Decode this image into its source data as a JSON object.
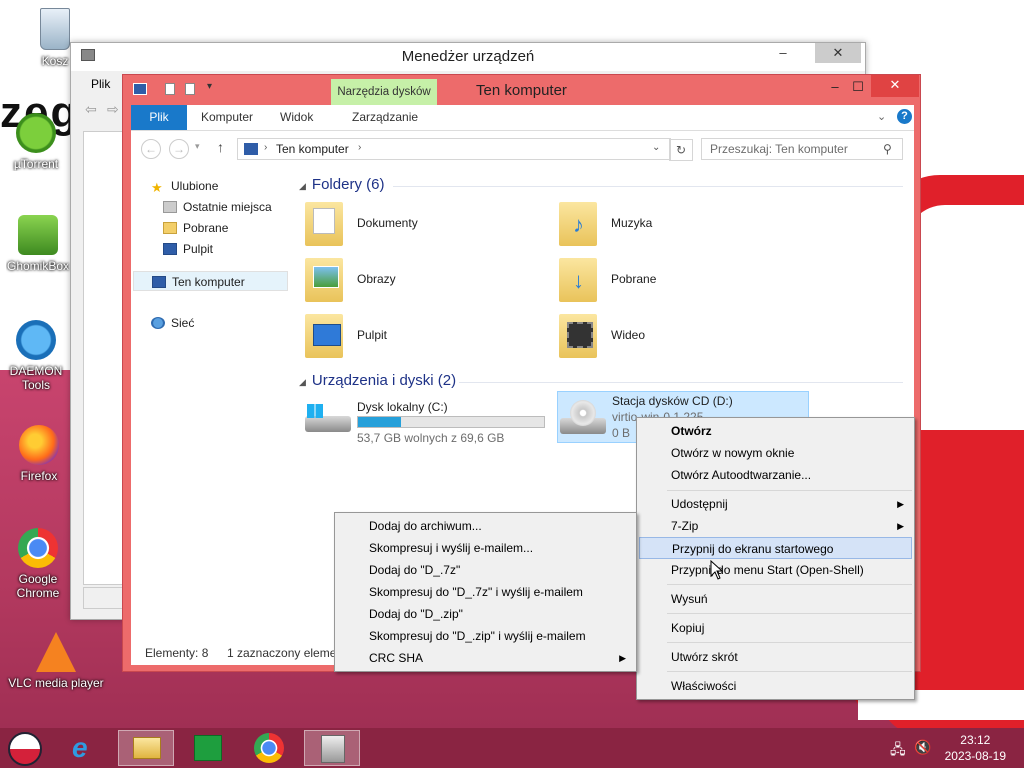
{
  "desktop": {
    "icons": [
      {
        "label": "Kosz",
        "icon": "recycle-bin-icon"
      },
      {
        "label": "µTorrent",
        "icon": "utorrent-icon"
      },
      {
        "label": "GhomikBox",
        "icon": "chomikbox-icon"
      },
      {
        "label": "DAEMON Tools",
        "icon": "daemon-tools-icon"
      },
      {
        "label": "Firefox",
        "icon": "firefox-icon"
      },
      {
        "label": "Google Chrome",
        "icon": "chrome-icon"
      },
      {
        "label": "VLC media player",
        "icon": "vlc-icon"
      }
    ],
    "wallpaper_text": "zeg"
  },
  "device_manager": {
    "title": "Menedżer urządzeń",
    "menu_file": "Plik"
  },
  "explorer": {
    "title": "Ten komputer",
    "ribbon": {
      "tabs": [
        "Plik",
        "Komputer",
        "Widok",
        "Zarządzanie"
      ],
      "contextual_tab": "Narzędzia dysków"
    },
    "address": {
      "path": "Ten komputer"
    },
    "search": {
      "placeholder": "Przeszukaj: Ten komputer"
    },
    "nav": {
      "favorites_label": "Ulubione",
      "favorites": [
        "Ostatnie miejsca",
        "Pobrane",
        "Pulpit"
      ],
      "this_pc": "Ten komputer",
      "network": "Sieć"
    },
    "folders_group": "Foldery (6)",
    "folders": [
      "Dokumenty",
      "Muzyka",
      "Obrazy",
      "Pobrane",
      "Pulpit",
      "Wideo"
    ],
    "devices_group": "Urządzenia i dyski (2)",
    "drives": [
      {
        "name": "Dysk lokalny (C:)",
        "free": "53,7 GB wolnych z 69,6 GB",
        "used_fraction": 0.23
      },
      {
        "name": "Stacja dysków CD (D:)",
        "line2": "virtio-win-0.1.225",
        "free": "0 B"
      }
    ],
    "status": {
      "count": "Elementy: 8",
      "selected": "1 zaznaczony element"
    }
  },
  "context_menu_main": [
    {
      "label": "Otwórz",
      "bold": true
    },
    {
      "label": "Otwórz w nowym oknie"
    },
    {
      "label": "Otwórz Autoodtwarzanie..."
    },
    {
      "label": "Udostępnij",
      "submenu": true
    },
    {
      "label": "7-Zip",
      "submenu": true
    },
    {
      "label": "Przypnij do ekranu startowego",
      "highlight": true
    },
    {
      "label": "Przypnij do menu Start (Open-Shell)"
    },
    {
      "label": "Wysuń"
    },
    {
      "label": "Kopiuj"
    },
    {
      "label": "Utwórz skrót"
    },
    {
      "label": "Właściwości"
    }
  ],
  "context_menu_7zip": [
    {
      "label": "Dodaj do archiwum..."
    },
    {
      "label": "Skompresuj i wyślij e-mailem..."
    },
    {
      "label": "Dodaj do \"D_.7z\""
    },
    {
      "label": "Skompresuj do \"D_.7z\" i wyślij e-mailem"
    },
    {
      "label": "Dodaj do \"D_.zip\""
    },
    {
      "label": "Skompresuj do \"D_.zip\" i wyślij e-mailem"
    },
    {
      "label": "CRC SHA",
      "submenu": true
    }
  ],
  "taskbar": {
    "time": "23:12",
    "date": "2023-08-19"
  }
}
